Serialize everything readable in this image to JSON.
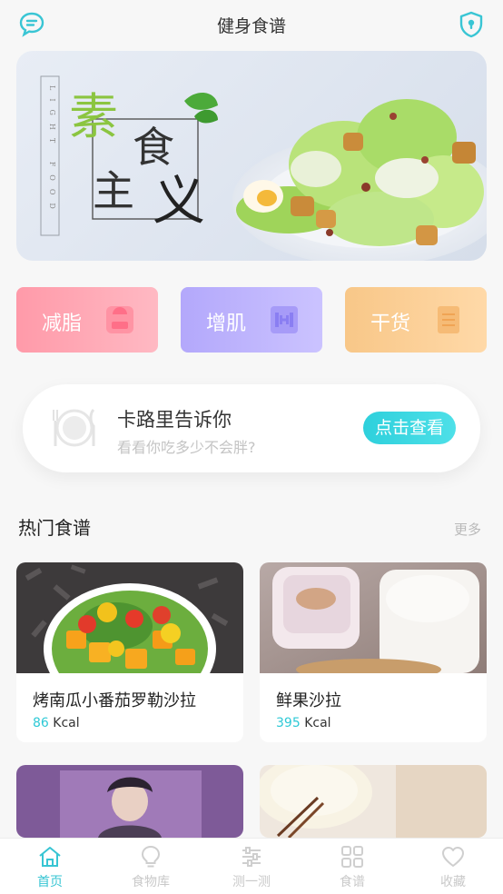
{
  "header": {
    "title": "健身食谱",
    "left_icon": "chat-bubble-icon",
    "right_icon": "shield-icon"
  },
  "banner": {
    "title_chars": [
      "素",
      "食",
      "主",
      "义"
    ],
    "vertical_text": "LIGHT FOOD"
  },
  "categories": [
    {
      "label": "减脂",
      "icon": "scale-icon",
      "color": "#ff9aa9"
    },
    {
      "label": "增肌",
      "icon": "dumbbell-icon",
      "color": "#b3a8fb"
    },
    {
      "label": "干货",
      "icon": "notepad-icon",
      "color": "#f8c788"
    }
  ],
  "calorie": {
    "title": "卡路里告诉你",
    "subtitle": "看看你吃多少不会胖?",
    "button": "点击查看"
  },
  "section": {
    "title": "热门食谱",
    "more": "更多"
  },
  "recipes": [
    {
      "name": "烤南瓜小番茄罗勒沙拉",
      "kcal": "86",
      "unit": "Kcal"
    },
    {
      "name": "鲜果沙拉",
      "kcal": "395",
      "unit": "Kcal"
    }
  ],
  "tabs": [
    {
      "label": "首页",
      "icon": "home-icon",
      "active": true
    },
    {
      "label": "食物库",
      "icon": "lightbulb-icon",
      "active": false
    },
    {
      "label": "测一测",
      "icon": "sliders-icon",
      "active": false
    },
    {
      "label": "食谱",
      "icon": "grid-icon",
      "active": false
    },
    {
      "label": "收藏",
      "icon": "heart-icon",
      "active": false
    }
  ],
  "colors": {
    "accent": "#37c5d3",
    "kcal": "#2ec9d6"
  }
}
